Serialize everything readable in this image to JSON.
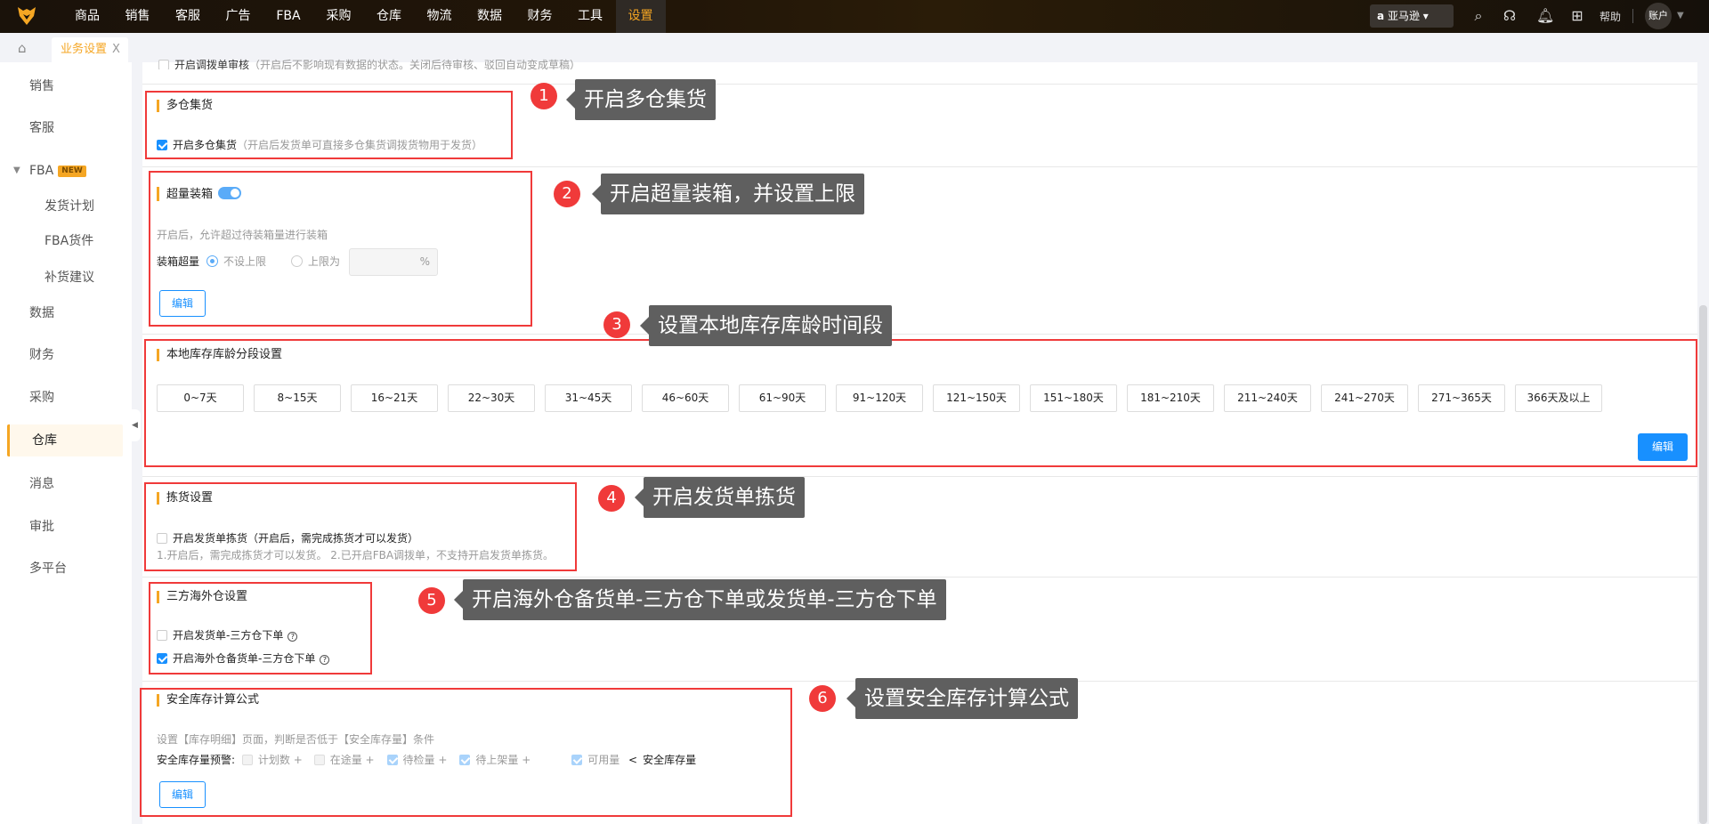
{
  "topnav": {
    "items": [
      "商品",
      "销售",
      "客服",
      "广告",
      "FBA",
      "采购",
      "仓库",
      "物流",
      "数据",
      "财务",
      "工具",
      "设置"
    ],
    "active": "设置",
    "platform": "亚马逊",
    "help": "帮助",
    "account": "账户"
  },
  "tabs": {
    "active": "业务设置",
    "close": "X"
  },
  "sidebar": {
    "items": [
      "销售",
      "客服",
      "FBA",
      "发货计划",
      "FBA货件",
      "补货建议",
      "数据",
      "财务",
      "采购",
      "仓库",
      "消息",
      "审批",
      "多平台"
    ],
    "badge": "NEW",
    "active": "仓库"
  },
  "top_partial": {
    "label": "开启调拨单审核",
    "hint": "（开启后不影响现有数据的状态。关闭后待审核、驳回自动变成草稿）"
  },
  "s1": {
    "title": "多仓集货",
    "label": "开启多仓集货",
    "hint": "（开启后发货单可直接多仓集货调拨货物用于发货）",
    "checked": true
  },
  "s2": {
    "title": "超量装箱",
    "enabled": true,
    "desc": "开启后，允许超过待装箱量进行装箱",
    "field": "装箱超量",
    "opt1": "不设上限",
    "opt2": "上限为",
    "unit": "%",
    "edit": "编辑"
  },
  "s3": {
    "title": "本地库存库龄分段设置",
    "segments": [
      "0~7天",
      "8~15天",
      "16~21天",
      "22~30天",
      "31~45天",
      "46~60天",
      "61~90天",
      "91~120天",
      "121~150天",
      "151~180天",
      "181~210天",
      "211~240天",
      "241~270天",
      "271~365天",
      "366天及以上"
    ],
    "edit": "编辑"
  },
  "s4": {
    "title": "拣货设置",
    "label": "开启发货单拣货（开启后，需完成拣货才可以发货）",
    "note": "1.开启后，需完成拣货才可以发货。 2.已开启FBA调拨单，不支持开启发货单拣货。",
    "checked": false
  },
  "s5": {
    "title": "三方海外仓设置",
    "opt1": "开启发货单-三方仓下单",
    "opt2": "开启海外仓备货单-三方仓下单",
    "opt1_checked": false,
    "opt2_checked": true
  },
  "s6": {
    "title": "安全库存计算公式",
    "desc": "设置【库存明细】页面，判断是否低于【安全库存量】条件",
    "label": "安全库存量预警:",
    "items": [
      "计划数",
      "在途量",
      "待检量",
      "待上架量",
      "可用量"
    ],
    "plus": "+",
    "lt": "<",
    "target": "安全库存量",
    "edit": "编辑"
  },
  "callouts": [
    {
      "n": "1",
      "text": "开启多仓集货"
    },
    {
      "n": "2",
      "text": "开启超量装箱，并设置上限"
    },
    {
      "n": "3",
      "text": "设置本地库存库龄时间段"
    },
    {
      "n": "4",
      "text": "开启发货单拣货"
    },
    {
      "n": "5",
      "text": "开启海外仓备货单-三方仓下单或发货单-三方仓下单"
    },
    {
      "n": "6",
      "text": "设置安全库存计算公式"
    }
  ]
}
